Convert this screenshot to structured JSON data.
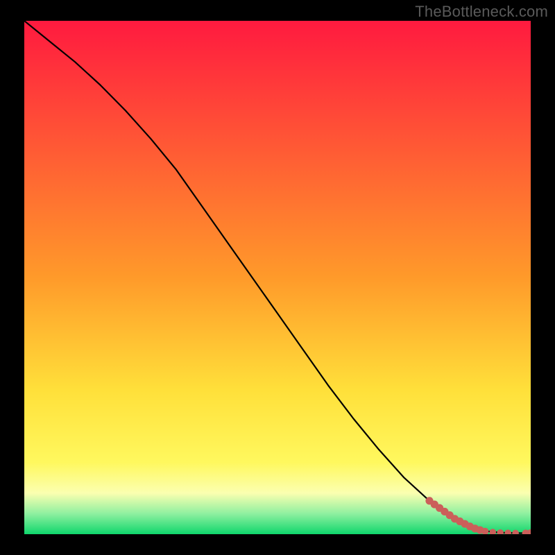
{
  "watermark": "TheBottleneck.com",
  "colors": {
    "black": "#000000",
    "line": "#000000",
    "marker": "#cb5f5a",
    "grad_top": "#ff1a3f",
    "grad_yellow1": "#ffe03a",
    "grad_yellow2": "#fff85e",
    "grad_paleyellow": "#fbffb0",
    "grad_green": "#28e07f",
    "grad_bottom": "#0fd66c"
  },
  "chart_data": {
    "type": "line",
    "title": "",
    "xlabel": "",
    "ylabel": "",
    "xlim": [
      0,
      100
    ],
    "ylim": [
      0,
      100
    ],
    "series": [
      {
        "name": "curve",
        "x": [
          0,
          5,
          10,
          15,
          20,
          25,
          30,
          35,
          40,
          45,
          50,
          55,
          60,
          65,
          70,
          75,
          80,
          85,
          88,
          90,
          92,
          94,
          96,
          98,
          100
        ],
        "y": [
          100,
          96,
          92,
          87.5,
          82.5,
          77,
          71,
          64,
          57,
          50,
          43,
          36,
          29,
          22.5,
          16.5,
          11,
          6.5,
          3,
          1.5,
          0.8,
          0.5,
          0.3,
          0.25,
          0.2,
          0.2
        ]
      }
    ],
    "markers": {
      "name": "highlight-points",
      "x": [
        80,
        81,
        82,
        83,
        84,
        85,
        86,
        87,
        88,
        89,
        90,
        91,
        92.5,
        94,
        95.5,
        97,
        99,
        100
      ],
      "y": [
        6.5,
        5.8,
        5.1,
        4.4,
        3.7,
        3,
        2.5,
        2.0,
        1.5,
        1.1,
        0.8,
        0.55,
        0.4,
        0.3,
        0.25,
        0.22,
        0.2,
        0.2
      ],
      "r": [
        3.5,
        3.5,
        3.5,
        3.5,
        3.5,
        3.5,
        3.5,
        3.5,
        3.5,
        3.5,
        3.5,
        3.2,
        3.0,
        3.0,
        3.0,
        3.0,
        3.2,
        3.5
      ]
    }
  }
}
